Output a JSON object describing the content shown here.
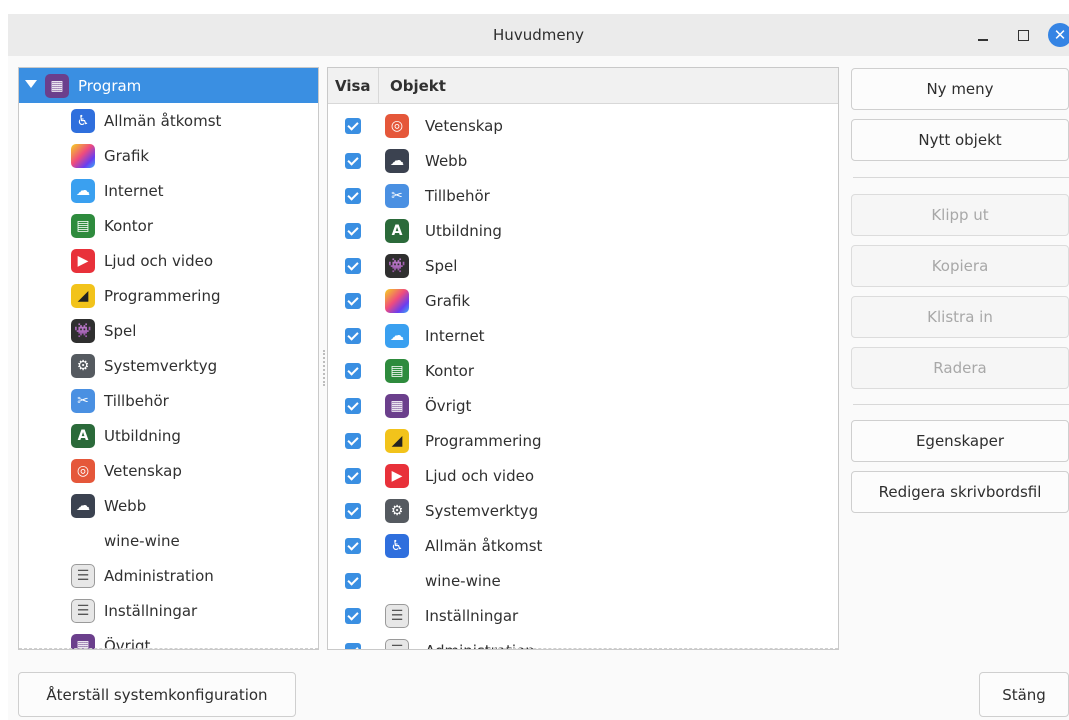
{
  "window": {
    "title": "Huvudmeny",
    "close_symbol": "✕"
  },
  "tree": {
    "root_label": "Program",
    "items": [
      {
        "label": "Allmän åtkomst",
        "icon": "accessibility-icon",
        "color": "#2f6fdd",
        "glyph": "♿"
      },
      {
        "label": "Grafik",
        "icon": "graphics-icon",
        "color": "#c23ad8",
        "glyph": ""
      },
      {
        "label": "Internet",
        "icon": "internet-icon",
        "color": "#3aa0f0",
        "glyph": "☁"
      },
      {
        "label": "Kontor",
        "icon": "office-icon",
        "color": "#2e8b3d",
        "glyph": "▤"
      },
      {
        "label": "Ljud och video",
        "icon": "sound-video-icon",
        "color": "#e8313a",
        "glyph": "▶"
      },
      {
        "label": "Programmering",
        "icon": "programming-icon",
        "color": "#f2c31b",
        "glyph": "◢"
      },
      {
        "label": "Spel",
        "icon": "games-icon",
        "color": "#2f2f2f",
        "glyph": "👾"
      },
      {
        "label": "Systemverktyg",
        "icon": "system-tools-icon",
        "color": "#555a60",
        "glyph": "⚙"
      },
      {
        "label": "Tillbehör",
        "icon": "accessories-icon",
        "color": "#4a90e2",
        "glyph": "✂"
      },
      {
        "label": "Utbildning",
        "icon": "education-icon",
        "color": "#2b6a3a",
        "glyph": "A"
      },
      {
        "label": "Vetenskap",
        "icon": "science-icon",
        "color": "#e5573a",
        "glyph": "◎"
      },
      {
        "label": "Webb",
        "icon": "web-icon",
        "color": "#3b4250",
        "glyph": "☁"
      },
      {
        "label": "wine-wine",
        "icon": "",
        "color": "",
        "glyph": ""
      },
      {
        "label": "Administration",
        "icon": "administration-icon",
        "color": "#e7e7e7",
        "glyph": "☰"
      },
      {
        "label": "Inställningar",
        "icon": "settings-icon",
        "color": "#e7e7e7",
        "glyph": "☰"
      },
      {
        "label": "Övrigt",
        "icon": "other-icon",
        "color": "#6b3f8c",
        "glyph": "▦"
      }
    ]
  },
  "list": {
    "col_show": "Visa",
    "col_object": "Objekt",
    "items": [
      {
        "label": "Vetenskap",
        "checked": true,
        "icon": "science-icon",
        "color": "#e5573a",
        "glyph": "◎"
      },
      {
        "label": "Webb",
        "checked": true,
        "icon": "web-icon",
        "color": "#3b4250",
        "glyph": "☁"
      },
      {
        "label": "Tillbehör",
        "checked": true,
        "icon": "accessories-icon",
        "color": "#4a90e2",
        "glyph": "✂"
      },
      {
        "label": "Utbildning",
        "checked": true,
        "icon": "education-icon",
        "color": "#2b6a3a",
        "glyph": "A"
      },
      {
        "label": "Spel",
        "checked": true,
        "icon": "games-icon",
        "color": "#2f2f2f",
        "glyph": "👾"
      },
      {
        "label": "Grafik",
        "checked": true,
        "icon": "graphics-icon",
        "color": "#c23ad8",
        "glyph": ""
      },
      {
        "label": "Internet",
        "checked": true,
        "icon": "internet-icon",
        "color": "#3aa0f0",
        "glyph": "☁"
      },
      {
        "label": "Kontor",
        "checked": true,
        "icon": "office-icon",
        "color": "#2e8b3d",
        "glyph": "▤"
      },
      {
        "label": "Övrigt",
        "checked": true,
        "icon": "other-icon",
        "color": "#6b3f8c",
        "glyph": "▦"
      },
      {
        "label": "Programmering",
        "checked": true,
        "icon": "programming-icon",
        "color": "#f2c31b",
        "glyph": "◢"
      },
      {
        "label": "Ljud och video",
        "checked": true,
        "icon": "sound-video-icon",
        "color": "#e8313a",
        "glyph": "▶"
      },
      {
        "label": "Systemverktyg",
        "checked": true,
        "icon": "system-tools-icon",
        "color": "#555a60",
        "glyph": "⚙"
      },
      {
        "label": "Allmän åtkomst",
        "checked": true,
        "icon": "accessibility-icon",
        "color": "#2f6fdd",
        "glyph": "♿"
      },
      {
        "label": "wine-wine",
        "checked": true,
        "icon": "",
        "color": "",
        "glyph": ""
      },
      {
        "label": "Inställningar",
        "checked": true,
        "icon": "settings-icon",
        "color": "#e7e7e7",
        "glyph": "☰"
      },
      {
        "label": "Administration",
        "checked": true,
        "icon": "administration-icon",
        "color": "#e7e7e7",
        "glyph": "☰"
      }
    ]
  },
  "actions": {
    "new_menu": "Ny meny",
    "new_item": "Nytt objekt",
    "cut": "Klipp ut",
    "copy": "Kopiera",
    "paste": "Klistra in",
    "delete": "Radera",
    "properties": "Egenskaper",
    "edit_desktop_file": "Redigera skrivbordsfil"
  },
  "footer": {
    "restore": "Återställ systemkonfiguration",
    "close": "Stäng"
  },
  "colors": {
    "accent": "#3a8fe2"
  }
}
